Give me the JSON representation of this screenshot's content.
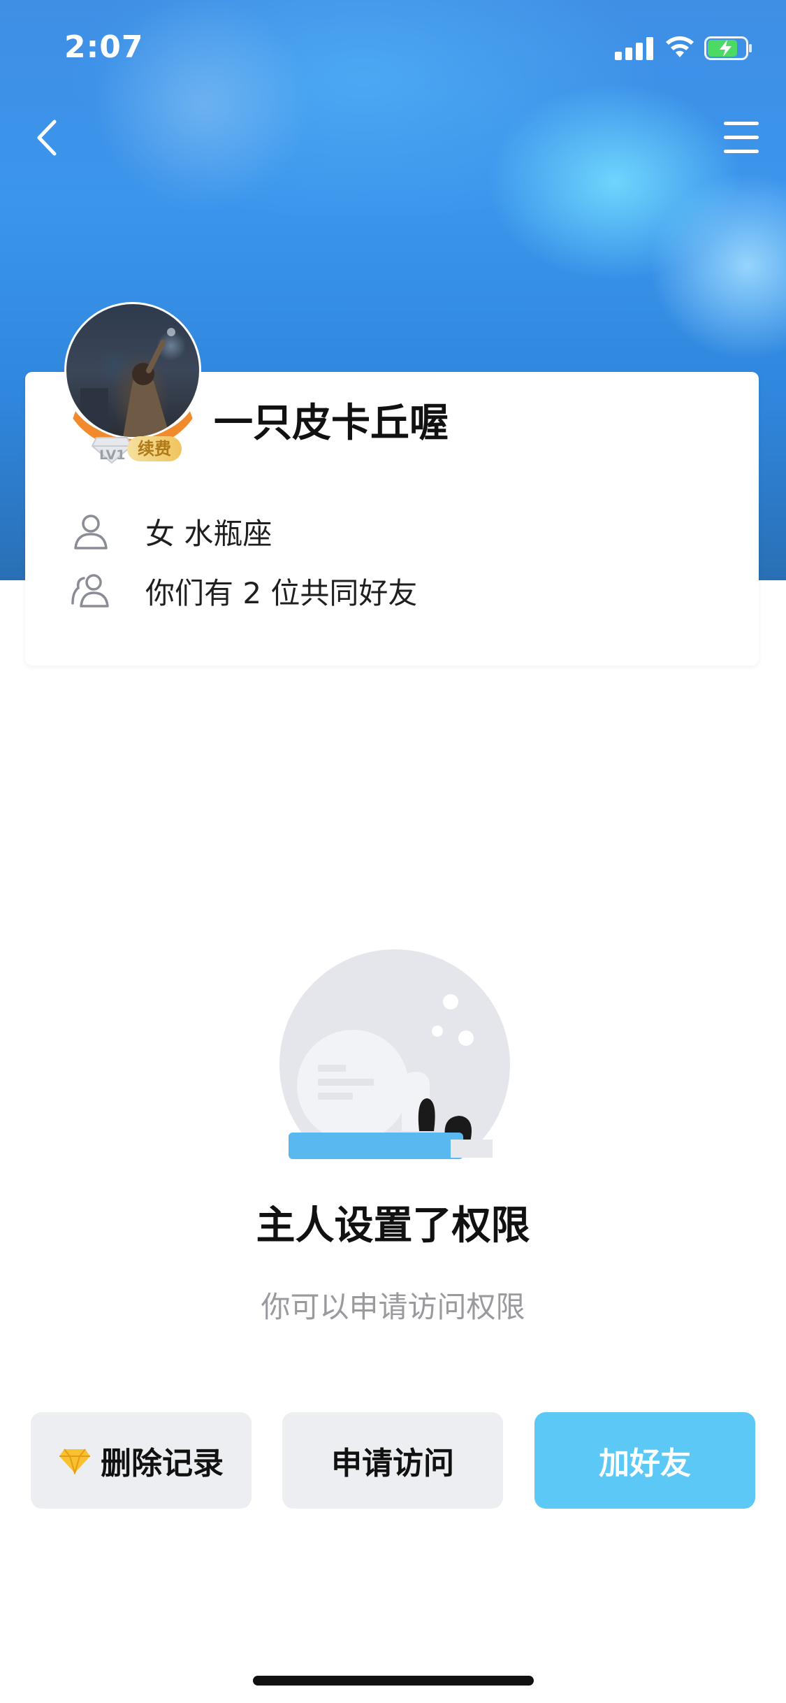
{
  "status_bar": {
    "time": "2:07"
  },
  "profile": {
    "nickname": "一只皮卡丘喔",
    "vip_level": "LV1",
    "vip_action": "续费",
    "gender_zodiac": "女 水瓶座",
    "mutual_friends": "你们有 2 位共同好友"
  },
  "permission": {
    "title": "主人设置了权限",
    "subtitle": "你可以申请访问权限"
  },
  "actions": {
    "delete_record": "删除记录",
    "request_access": "申请访问",
    "add_friend": "加好友"
  },
  "colors": {
    "accent": "#5bc8f5",
    "vip_ring": "#f08a2c",
    "button_bg": "#edeef2"
  }
}
